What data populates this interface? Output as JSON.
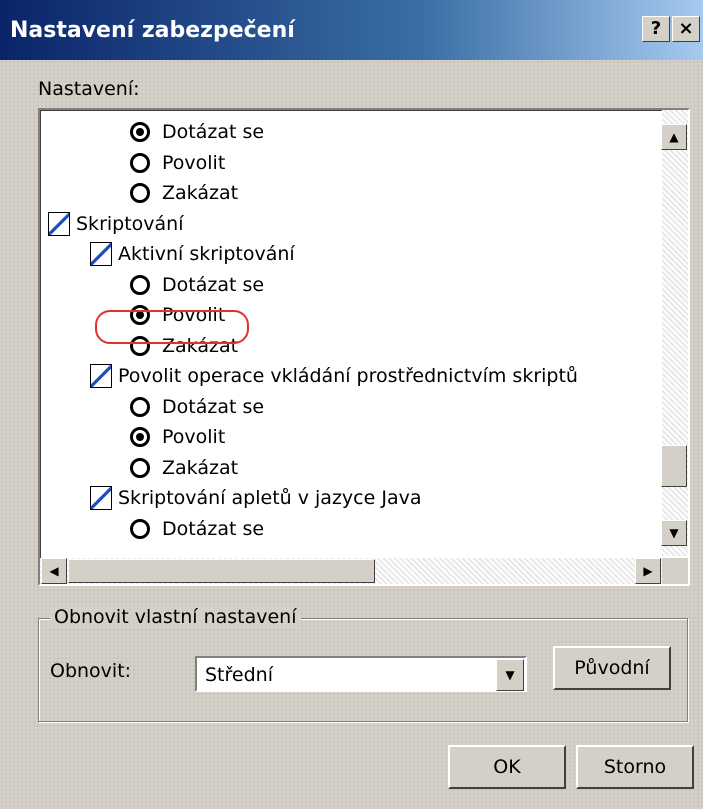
{
  "window": {
    "title": "Nastavení zabezpečení",
    "help_label": "?",
    "close_label": "×"
  },
  "settings_label": "Nastavení:",
  "tree": [
    {
      "type": "radio",
      "label": "Dotázat se",
      "selected": true,
      "level": 2
    },
    {
      "type": "radio",
      "label": "Povolit",
      "selected": false,
      "level": 2
    },
    {
      "type": "radio",
      "label": "Zakázat",
      "selected": false,
      "level": 2
    },
    {
      "type": "category",
      "label": "Skriptování",
      "level": 0
    },
    {
      "type": "category",
      "label": "Aktivní skriptování",
      "level": 1
    },
    {
      "type": "radio",
      "label": "Dotázat se",
      "selected": false,
      "level": 2
    },
    {
      "type": "radio",
      "label": "Povolit",
      "selected": true,
      "level": 2,
      "highlighted": true
    },
    {
      "type": "radio",
      "label": "Zakázat",
      "selected": false,
      "level": 2
    },
    {
      "type": "category",
      "label": "Povolit operace vkládání prostřednictvím skriptů",
      "level": 1
    },
    {
      "type": "radio",
      "label": "Dotázat se",
      "selected": false,
      "level": 2
    },
    {
      "type": "radio",
      "label": "Povolit",
      "selected": true,
      "level": 2
    },
    {
      "type": "radio",
      "label": "Zakázat",
      "selected": false,
      "level": 2
    },
    {
      "type": "category",
      "label": "Skriptování apletů v jazyce Java",
      "level": 1
    },
    {
      "type": "radio",
      "label": "Dotázat se",
      "selected": false,
      "level": 2
    }
  ],
  "reset_group": {
    "title": "Obnovit vlastní nastavení",
    "restore_label": "Obnovit:",
    "level_value": "Střední",
    "reset_button": "Původní"
  },
  "buttons": {
    "ok": "OK",
    "cancel": "Storno"
  },
  "icons": {
    "category": "script-settings-icon",
    "scroll_up": "▲",
    "scroll_down": "▼",
    "scroll_left": "◀",
    "scroll_right": "▶",
    "dropdown": "▼"
  }
}
